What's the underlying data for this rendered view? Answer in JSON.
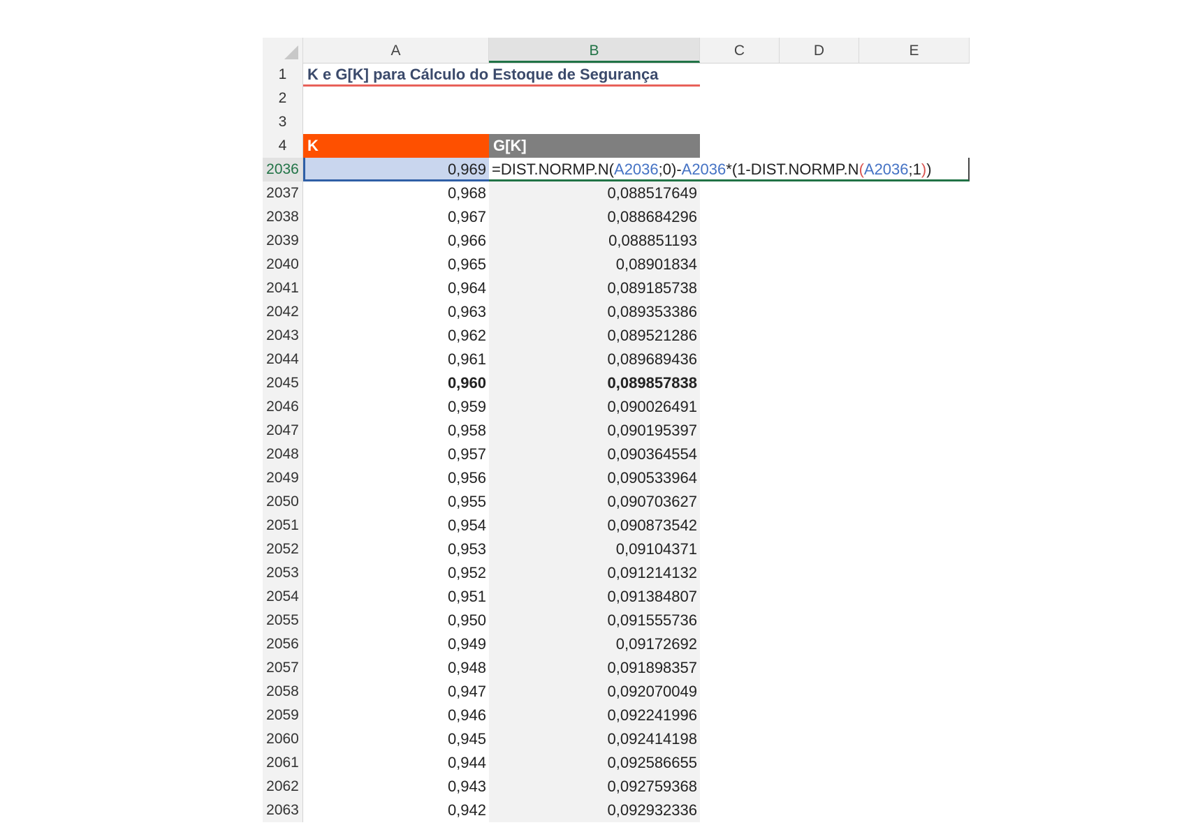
{
  "columns": [
    "A",
    "B",
    "C",
    "D",
    "E"
  ],
  "title": "K e G[K] para Cálculo do Estoque de Segurança",
  "header_row": {
    "row": "4",
    "k_label": "K",
    "gk_label": "G[K]"
  },
  "top_rows": [
    "1",
    "2",
    "3"
  ],
  "active_row": {
    "row": "2036",
    "k": "0,969",
    "formula": {
      "p1": "=DIST.NORMP.N(",
      "r1": "A2036",
      "p2": ";0)-",
      "r2": "A2036",
      "p3": "*(1-DIST.NORMP.N",
      "p4": "(",
      "r3": "A2036",
      "p5": ";1",
      "p6": ")",
      "p7": ")"
    }
  },
  "rows": [
    {
      "row": "2037",
      "k": "0,968",
      "gk": "0,088517649"
    },
    {
      "row": "2038",
      "k": "0,967",
      "gk": "0,088684296"
    },
    {
      "row": "2039",
      "k": "0,966",
      "gk": "0,088851193"
    },
    {
      "row": "2040",
      "k": "0,965",
      "gk": "0,08901834"
    },
    {
      "row": "2041",
      "k": "0,964",
      "gk": "0,089185738"
    },
    {
      "row": "2042",
      "k": "0,963",
      "gk": "0,089353386"
    },
    {
      "row": "2043",
      "k": "0,962",
      "gk": "0,089521286"
    },
    {
      "row": "2044",
      "k": "0,961",
      "gk": "0,089689436"
    },
    {
      "row": "2045",
      "k": "0,960",
      "gk": "0,089857838",
      "bold": true
    },
    {
      "row": "2046",
      "k": "0,959",
      "gk": "0,090026491"
    },
    {
      "row": "2047",
      "k": "0,958",
      "gk": "0,090195397"
    },
    {
      "row": "2048",
      "k": "0,957",
      "gk": "0,090364554"
    },
    {
      "row": "2049",
      "k": "0,956",
      "gk": "0,090533964"
    },
    {
      "row": "2050",
      "k": "0,955",
      "gk": "0,090703627"
    },
    {
      "row": "2051",
      "k": "0,954",
      "gk": "0,090873542"
    },
    {
      "row": "2052",
      "k": "0,953",
      "gk": "0,09104371"
    },
    {
      "row": "2053",
      "k": "0,952",
      "gk": "0,091214132"
    },
    {
      "row": "2054",
      "k": "0,951",
      "gk": "0,091384807"
    },
    {
      "row": "2055",
      "k": "0,950",
      "gk": "0,091555736"
    },
    {
      "row": "2056",
      "k": "0,949",
      "gk": "0,09172692"
    },
    {
      "row": "2057",
      "k": "0,948",
      "gk": "0,091898357"
    },
    {
      "row": "2058",
      "k": "0,947",
      "gk": "0,092070049"
    },
    {
      "row": "2059",
      "k": "0,946",
      "gk": "0,092241996"
    },
    {
      "row": "2060",
      "k": "0,945",
      "gk": "0,092414198"
    },
    {
      "row": "2061",
      "k": "0,944",
      "gk": "0,092586655"
    },
    {
      "row": "2062",
      "k": "0,943",
      "gk": "0,092759368"
    },
    {
      "row": "2063",
      "k": "0,942",
      "gk": "0,092932336"
    }
  ],
  "colors": {
    "k_header": "#fe5000",
    "gk_header": "#7f7f7f",
    "title": "#3b4a6b",
    "title_underline": "#e8615a",
    "selection": "#c9d6ee",
    "active_accent": "#217346",
    "reference": "#4472c4"
  }
}
